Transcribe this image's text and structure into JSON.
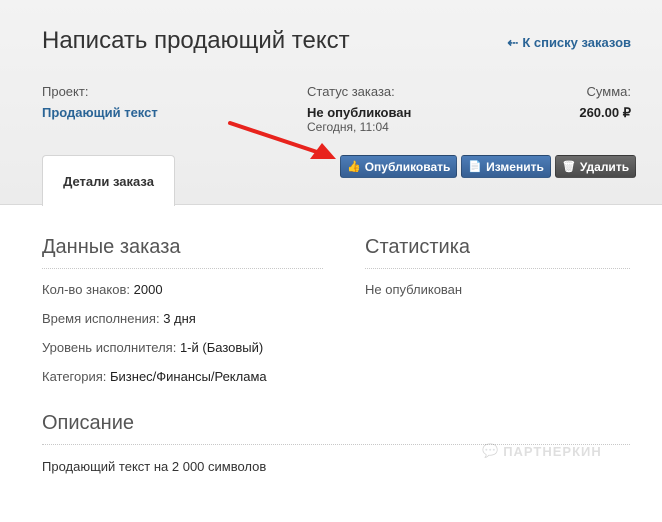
{
  "header": {
    "title": "Написать продающий текст",
    "back_link": "К списку заказов"
  },
  "meta": {
    "project_label": "Проект:",
    "project_value": "Продающий текст",
    "status_label": "Статус заказа:",
    "status_value": "Не опубликован",
    "status_date": "Сегодня, 11:04",
    "sum_label": "Сумма:",
    "sum_value": "260.00 ₽"
  },
  "tabs": {
    "active": "Детали заказа"
  },
  "actions": {
    "publish": "Опубликовать",
    "edit": "Изменить",
    "delete": "Удалить"
  },
  "order_data": {
    "title": "Данные заказа",
    "rows": [
      {
        "label": "Кол-во знаков:",
        "value": "2000"
      },
      {
        "label": "Время исполнения:",
        "value": "3 дня"
      },
      {
        "label": "Уровень исполнителя:",
        "value": "1-й (Базовый)"
      },
      {
        "label": "Категория:",
        "value": "Бизнес/Финансы/Реклама"
      }
    ]
  },
  "stats": {
    "title": "Статистика",
    "value": "Не опубликован"
  },
  "description": {
    "title": "Описание",
    "text": "Продающий текст на 2 000 символов"
  },
  "watermark": "ПАРТНЕРКИН",
  "colors": {
    "link": "#2a6496",
    "primary_button": "#3e6ca6",
    "delete_button": "#555555",
    "annotation_arrow": "#e8231d"
  }
}
